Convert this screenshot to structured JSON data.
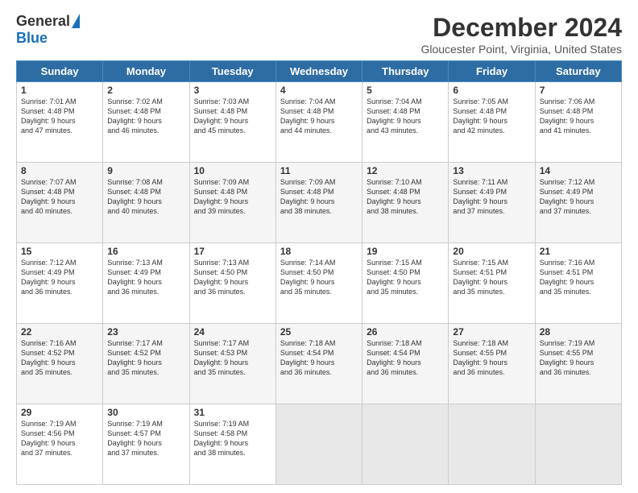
{
  "logo": {
    "general": "General",
    "blue": "Blue"
  },
  "title": "December 2024",
  "subtitle": "Gloucester Point, Virginia, United States",
  "header_days": [
    "Sunday",
    "Monday",
    "Tuesday",
    "Wednesday",
    "Thursday",
    "Friday",
    "Saturday"
  ],
  "weeks": [
    [
      {
        "day": "1",
        "sunrise": "7:01 AM",
        "sunset": "4:48 PM",
        "daylight": "9 hours and 47 minutes."
      },
      {
        "day": "2",
        "sunrise": "7:02 AM",
        "sunset": "4:48 PM",
        "daylight": "9 hours and 46 minutes."
      },
      {
        "day": "3",
        "sunrise": "7:03 AM",
        "sunset": "4:48 PM",
        "daylight": "9 hours and 45 minutes."
      },
      {
        "day": "4",
        "sunrise": "7:04 AM",
        "sunset": "4:48 PM",
        "daylight": "9 hours and 44 minutes."
      },
      {
        "day": "5",
        "sunrise": "7:04 AM",
        "sunset": "4:48 PM",
        "daylight": "9 hours and 43 minutes."
      },
      {
        "day": "6",
        "sunrise": "7:05 AM",
        "sunset": "4:48 PM",
        "daylight": "9 hours and 42 minutes."
      },
      {
        "day": "7",
        "sunrise": "7:06 AM",
        "sunset": "4:48 PM",
        "daylight": "9 hours and 41 minutes."
      }
    ],
    [
      {
        "day": "8",
        "sunrise": "7:07 AM",
        "sunset": "4:48 PM",
        "daylight": "9 hours and 40 minutes."
      },
      {
        "day": "9",
        "sunrise": "7:08 AM",
        "sunset": "4:48 PM",
        "daylight": "9 hours and 40 minutes."
      },
      {
        "day": "10",
        "sunrise": "7:09 AM",
        "sunset": "4:48 PM",
        "daylight": "9 hours and 39 minutes."
      },
      {
        "day": "11",
        "sunrise": "7:09 AM",
        "sunset": "4:48 PM",
        "daylight": "9 hours and 38 minutes."
      },
      {
        "day": "12",
        "sunrise": "7:10 AM",
        "sunset": "4:48 PM",
        "daylight": "9 hours and 38 minutes."
      },
      {
        "day": "13",
        "sunrise": "7:11 AM",
        "sunset": "4:49 PM",
        "daylight": "9 hours and 37 minutes."
      },
      {
        "day": "14",
        "sunrise": "7:12 AM",
        "sunset": "4:49 PM",
        "daylight": "9 hours and 37 minutes."
      }
    ],
    [
      {
        "day": "15",
        "sunrise": "7:12 AM",
        "sunset": "4:49 PM",
        "daylight": "9 hours and 36 minutes."
      },
      {
        "day": "16",
        "sunrise": "7:13 AM",
        "sunset": "4:49 PM",
        "daylight": "9 hours and 36 minutes."
      },
      {
        "day": "17",
        "sunrise": "7:13 AM",
        "sunset": "4:50 PM",
        "daylight": "9 hours and 36 minutes."
      },
      {
        "day": "18",
        "sunrise": "7:14 AM",
        "sunset": "4:50 PM",
        "daylight": "9 hours and 35 minutes."
      },
      {
        "day": "19",
        "sunrise": "7:15 AM",
        "sunset": "4:50 PM",
        "daylight": "9 hours and 35 minutes."
      },
      {
        "day": "20",
        "sunrise": "7:15 AM",
        "sunset": "4:51 PM",
        "daylight": "9 hours and 35 minutes."
      },
      {
        "day": "21",
        "sunrise": "7:16 AM",
        "sunset": "4:51 PM",
        "daylight": "9 hours and 35 minutes."
      }
    ],
    [
      {
        "day": "22",
        "sunrise": "7:16 AM",
        "sunset": "4:52 PM",
        "daylight": "9 hours and 35 minutes."
      },
      {
        "day": "23",
        "sunrise": "7:17 AM",
        "sunset": "4:52 PM",
        "daylight": "9 hours and 35 minutes."
      },
      {
        "day": "24",
        "sunrise": "7:17 AM",
        "sunset": "4:53 PM",
        "daylight": "9 hours and 35 minutes."
      },
      {
        "day": "25",
        "sunrise": "7:18 AM",
        "sunset": "4:54 PM",
        "daylight": "9 hours and 36 minutes."
      },
      {
        "day": "26",
        "sunrise": "7:18 AM",
        "sunset": "4:54 PM",
        "daylight": "9 hours and 36 minutes."
      },
      {
        "day": "27",
        "sunrise": "7:18 AM",
        "sunset": "4:55 PM",
        "daylight": "9 hours and 36 minutes."
      },
      {
        "day": "28",
        "sunrise": "7:19 AM",
        "sunset": "4:55 PM",
        "daylight": "9 hours and 36 minutes."
      }
    ],
    [
      {
        "day": "29",
        "sunrise": "7:19 AM",
        "sunset": "4:56 PM",
        "daylight": "9 hours and 37 minutes."
      },
      {
        "day": "30",
        "sunrise": "7:19 AM",
        "sunset": "4:57 PM",
        "daylight": "9 hours and 37 minutes."
      },
      {
        "day": "31",
        "sunrise": "7:19 AM",
        "sunset": "4:58 PM",
        "daylight": "9 hours and 38 minutes."
      },
      null,
      null,
      null,
      null
    ]
  ],
  "labels": {
    "sunrise": "Sunrise: ",
    "sunset": "Sunset: ",
    "daylight": "Daylight: "
  }
}
